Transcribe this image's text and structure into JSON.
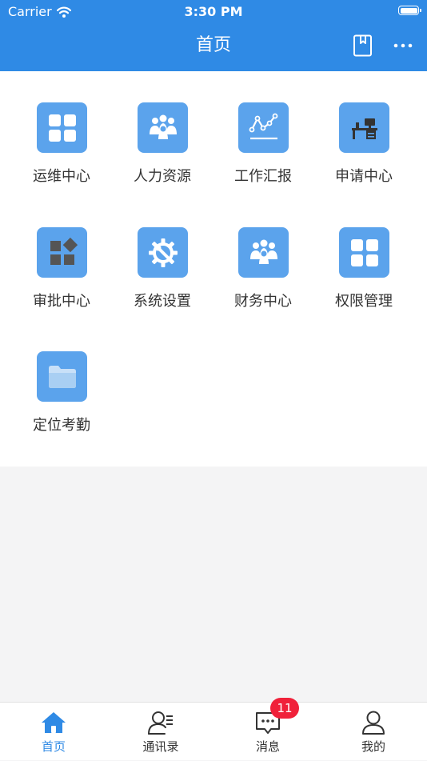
{
  "status_bar": {
    "carrier": "Carrier",
    "time": "3:30 PM"
  },
  "header": {
    "title": "首页",
    "bookmark_icon": "bookmark-icon",
    "more_icon": "more-icon"
  },
  "modules": [
    {
      "label": "运维中心",
      "icon": "grid-icon"
    },
    {
      "label": "人力资源",
      "icon": "people-icon"
    },
    {
      "label": "工作汇报",
      "icon": "line-chart-icon"
    },
    {
      "label": "申请中心",
      "icon": "desk-icon"
    },
    {
      "label": "审批中心",
      "icon": "blocks-icon"
    },
    {
      "label": "系统设置",
      "icon": "gear-wrench-icon"
    },
    {
      "label": "财务中心",
      "icon": "people-icon"
    },
    {
      "label": "权限管理",
      "icon": "grid-icon"
    },
    {
      "label": "定位考勤",
      "icon": "folder-icon"
    }
  ],
  "tabbar": {
    "tabs": [
      {
        "label": "首页",
        "icon": "home-icon",
        "active": true
      },
      {
        "label": "通讯录",
        "icon": "contacts-icon"
      },
      {
        "label": "消息",
        "icon": "message-icon"
      },
      {
        "label": "我的",
        "icon": "profile-icon"
      }
    ],
    "message_badge": "11"
  },
  "colors": {
    "primary": "#2f8ae5",
    "tile": "#5ba3ec",
    "badge": "#f0213a",
    "icon_dark": "#555555"
  }
}
